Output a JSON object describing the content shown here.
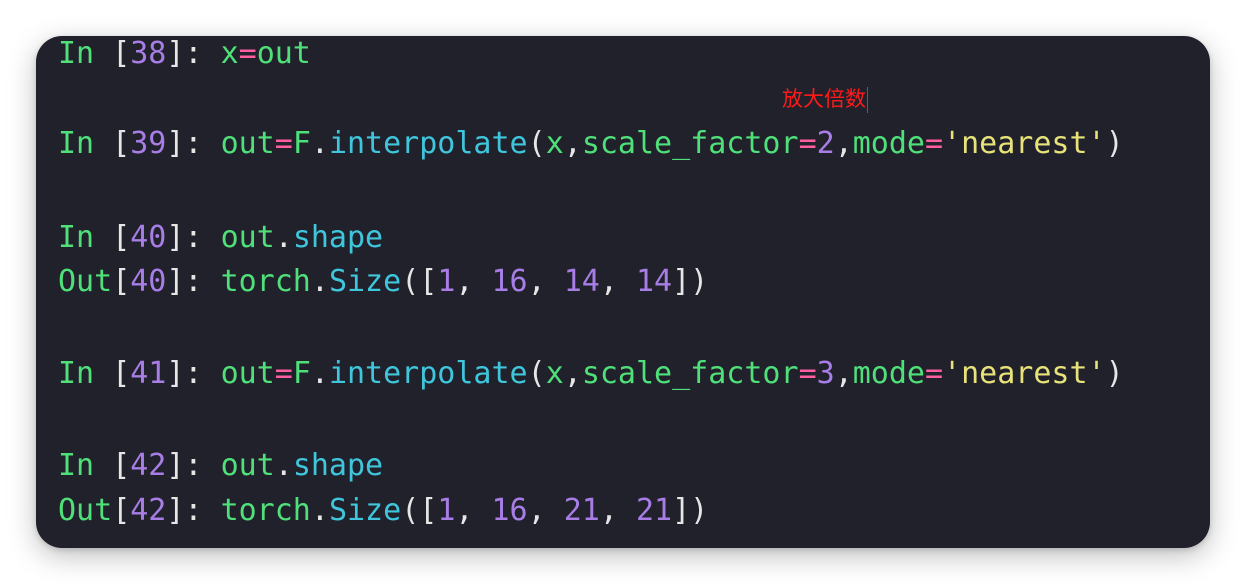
{
  "annotation": {
    "text": "放大倍数"
  },
  "colors": {
    "background": "#20212b",
    "prompt": "#4fe07a",
    "function": "#3fc6dc",
    "number": "#a87ee6",
    "string": "#e8e27a",
    "operator": "#ff5fa0",
    "annotation": "#ff1a1a"
  },
  "cells": [
    {
      "prompt": "In",
      "num": "38",
      "code": {
        "lhs": "x",
        "op": "=",
        "rhs": "out"
      }
    },
    {
      "prompt": "In",
      "num": "39",
      "code": {
        "lhs": "out",
        "op": "=",
        "obj": "F",
        "func": "interpolate",
        "arg1": "x",
        "kw1": "scale_factor",
        "val1": "2",
        "kw2": "mode",
        "val2": "'nearest'"
      }
    },
    {
      "prompt": "In",
      "num": "40",
      "code": {
        "obj": "out",
        "attr": "shape"
      }
    },
    {
      "prompt": "Out",
      "num": "40",
      "result": {
        "obj": "torch",
        "cls": "Size",
        "dims": [
          "1",
          "16",
          "14",
          "14"
        ]
      }
    },
    {
      "prompt": "In",
      "num": "41",
      "code": {
        "lhs": "out",
        "op": "=",
        "obj": "F",
        "func": "interpolate",
        "arg1": "x",
        "kw1": "scale_factor",
        "val1": "3",
        "kw2": "mode",
        "val2": "'nearest'"
      }
    },
    {
      "prompt": "In",
      "num": "42",
      "code": {
        "obj": "out",
        "attr": "shape"
      }
    },
    {
      "prompt": "Out",
      "num": "42",
      "result": {
        "obj": "torch",
        "cls": "Size",
        "dims": [
          "1",
          "16",
          "21",
          "21"
        ]
      }
    }
  ]
}
